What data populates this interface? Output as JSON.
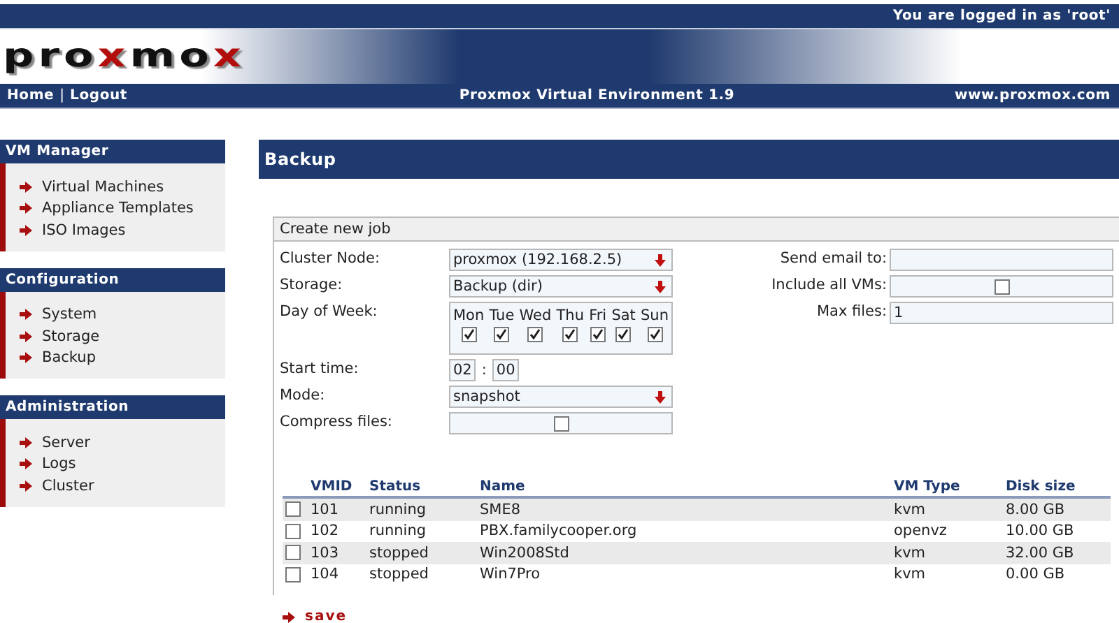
{
  "header": {
    "user_text": "You are logged in as 'root'",
    "logo": [
      {
        "text": "pro",
        "kind": "plain"
      },
      {
        "text": "x",
        "kind": "accent"
      },
      {
        "text": "mo",
        "kind": "plain"
      },
      {
        "text": "x",
        "kind": "accent"
      }
    ],
    "nav": {
      "links": [
        "Home",
        "Logout"
      ],
      "separator": "|"
    },
    "title": "Proxmox Virtual Environment 1.9",
    "site": "www.proxmox.com"
  },
  "sidebar": {
    "sections": [
      {
        "title": "VM Manager",
        "items": [
          {
            "label": "Virtual Machines"
          },
          {
            "label": "Appliance Templates"
          },
          {
            "label": "ISO Images"
          }
        ]
      },
      {
        "title": "Configuration",
        "items": [
          {
            "label": "System"
          },
          {
            "label": "Storage"
          },
          {
            "label": "Backup"
          }
        ]
      },
      {
        "title": "Administration",
        "items": [
          {
            "label": "Server"
          },
          {
            "label": "Logs"
          },
          {
            "label": "Cluster"
          }
        ]
      }
    ]
  },
  "page_title": "Backup",
  "form": {
    "legend": "Create new job",
    "left_fields": [
      {
        "kind": "select",
        "label": "Cluster Node:",
        "value": "proxmox (192.168.2.5)"
      },
      {
        "kind": "select",
        "label": "Storage:",
        "value": "Backup (dir)"
      },
      {
        "kind": "days",
        "label": "Day of Week:",
        "days": [
          {
            "label": "Mon",
            "checked": true
          },
          {
            "label": "Tue",
            "checked": true
          },
          {
            "label": "Wed",
            "checked": true
          },
          {
            "label": "Thu",
            "checked": true
          },
          {
            "label": "Fri",
            "checked": true
          },
          {
            "label": "Sat",
            "checked": true
          },
          {
            "label": "Sun",
            "checked": true
          }
        ]
      },
      {
        "kind": "time",
        "label": "Start time:",
        "hour": "02",
        "separator": ":",
        "minute": "00"
      },
      {
        "kind": "select",
        "label": "Mode:",
        "value": "snapshot"
      },
      {
        "kind": "checkbox",
        "label": "Compress files:",
        "checked": false
      }
    ],
    "right_fields": [
      {
        "kind": "text",
        "label": "Send email to:"
      },
      {
        "kind": "checkbox",
        "label": "Include all VMs:",
        "checked": false
      },
      {
        "kind": "text",
        "label": "Max files:",
        "value": "1"
      }
    ]
  },
  "table": {
    "columns": [
      "VMID",
      "Status",
      "Name",
      "VM Type",
      "Disk size"
    ],
    "rows": [
      {
        "checked": false,
        "cells": [
          "101",
          "running",
          "SME8",
          "kvm",
          "8.00 GB"
        ]
      },
      {
        "checked": false,
        "cells": [
          "102",
          "running",
          "PBX.familycooper.org",
          "openvz",
          "10.00 GB"
        ]
      },
      {
        "checked": false,
        "cells": [
          "103",
          "stopped",
          "Win2008Std",
          "kvm",
          "32.00 GB"
        ]
      },
      {
        "checked": false,
        "cells": [
          "104",
          "stopped",
          "Win7Pro",
          "kvm",
          "0.00 GB"
        ]
      }
    ]
  },
  "save": "save"
}
